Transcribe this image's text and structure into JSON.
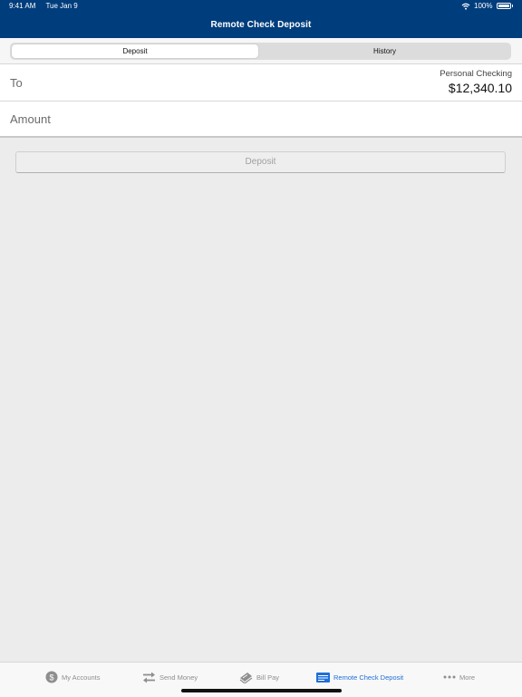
{
  "status_bar": {
    "time": "9:41 AM",
    "date": "Tue Jan 9",
    "battery": "100%"
  },
  "header": {
    "title": "Remote Check Deposit"
  },
  "segments": {
    "deposit": "Deposit",
    "history": "History"
  },
  "to_row": {
    "label": "To",
    "account_name": "Personal Checking",
    "balance": "$12,340.10"
  },
  "amount_row": {
    "label": "Amount"
  },
  "deposit_button": {
    "label": "Deposit"
  },
  "tabbar": {
    "items": [
      {
        "label": "My Accounts",
        "icon": "dollar-coin-icon"
      },
      {
        "label": "Send Money",
        "icon": "transfer-arrows-icon"
      },
      {
        "label": "Bill Pay",
        "icon": "bill-pay-icon"
      },
      {
        "label": "Remote Check Deposit",
        "icon": "check-icon",
        "active": true
      },
      {
        "label": "More",
        "icon": "more-dots-icon"
      }
    ]
  },
  "colors": {
    "header_bg": "#003d7c",
    "accent": "#1e6fd8",
    "background": "#ececec"
  }
}
